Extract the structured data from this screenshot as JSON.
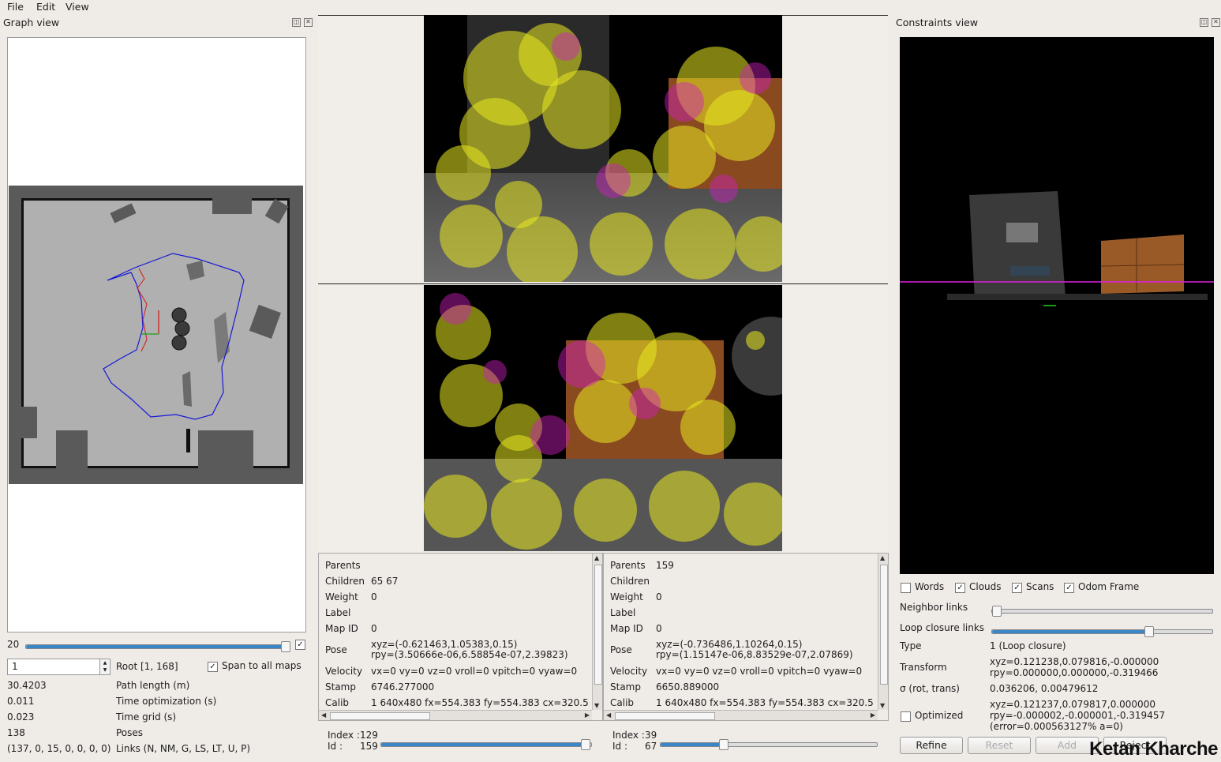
{
  "menu": {
    "file": "File",
    "edit": "Edit",
    "view": "View"
  },
  "graph_view": {
    "title": "Graph view",
    "slider_value": "20",
    "slider_fraction": 1.0,
    "spin_value": "1",
    "root_label": "Root [1, 168]",
    "span_label": "Span to all maps",
    "span_checked": true,
    "stats": [
      {
        "value": "30.4203",
        "label": "Path length (m)"
      },
      {
        "value": "0.011",
        "label": "Time optimization (s)"
      },
      {
        "value": "0.023",
        "label": "Time grid (s)"
      },
      {
        "value": "138",
        "label": "Poses"
      },
      {
        "value": "(137, 0, 15, 0, 0, 0, 0)",
        "label": "Links (N, NM, G, LS, LT, U, P)"
      }
    ]
  },
  "node_left": {
    "parents_label": "Parents",
    "parents": "",
    "children_label": "Children",
    "children": "65 67",
    "weight_label": "Weight",
    "weight": "0",
    "label_label": "Label",
    "label": "",
    "mapid_label": "Map ID",
    "mapid": "0",
    "pose_label": "Pose",
    "pose_xyz": "xyz=(-0.621463,1.05383,0.15)",
    "pose_rpy": "rpy=(3.50666e-06,6.58854e-07,2.39823)",
    "velocity_label": "Velocity",
    "velocity": "vx=0 vy=0 vz=0 vroll=0 vpitch=0 vyaw=0",
    "stamp_label": "Stamp",
    "stamp": "6746.277000",
    "calib_label": "Calib",
    "calib": "1 640x480 fx=554.383 fy=554.383 cx=320.5",
    "index_label": "Index :",
    "index": "129",
    "id_label": "Id :",
    "id": "159",
    "slider_fraction": 0.97
  },
  "node_right": {
    "parents_label": "Parents",
    "parents": "159",
    "children_label": "Children",
    "children": "",
    "weight_label": "Weight",
    "weight": "0",
    "label_label": "Label",
    "label": "",
    "mapid_label": "Map ID",
    "mapid": "0",
    "pose_label": "Pose",
    "pose_xyz": "xyz=(-0.736486,1.10264,0.15)",
    "pose_rpy": "rpy=(1.15147e-06,8.83529e-07,2.07869)",
    "velocity_label": "Velocity",
    "velocity": "vx=0 vy=0 vz=0 vroll=0 vpitch=0 vyaw=0",
    "stamp_label": "Stamp",
    "stamp": "6650.889000",
    "calib_label": "Calib",
    "calib": "1 640x480 fx=554.383 fy=554.383 cx=320.5",
    "index_label": "Index :",
    "index": "39",
    "id_label": "Id :",
    "id": "67",
    "slider_fraction": 0.29
  },
  "constraints_view": {
    "title": "Constraints view",
    "checks": [
      {
        "label": "Words",
        "checked": false
      },
      {
        "label": "Clouds",
        "checked": true
      },
      {
        "label": "Scans",
        "checked": true
      },
      {
        "label": "Odom Frame",
        "checked": true
      }
    ],
    "neighbor_links_label": "Neighbor links",
    "neighbor_fraction": 0.0,
    "loop_links_label": "Loop closure links",
    "loop_fraction": 0.71,
    "type_label": "Type",
    "type_value": "1 (Loop closure)",
    "transform_label": "Transform",
    "transform_xyz": "xyz=0.121238,0.079816,-0.000000",
    "transform_rpy": "rpy=0.000000,0.000000,-0.319466",
    "sigma_label": "σ (rot, trans)",
    "sigma_value": "0.036206, 0.00479612",
    "optimized_label": "Optimized",
    "optimized_checked": false,
    "opt_xyz": "xyz=0.121237,0.079817,0.000000",
    "opt_rpy": "rpy=-0.000002,-0.000001,-0.319457",
    "opt_error": "(error=0.000563127% a=0)",
    "buttons": {
      "refine": "Refine",
      "reset": "Reset",
      "add": "Add",
      "reject": "Reject"
    }
  },
  "watermark": "Ketan Kharche"
}
